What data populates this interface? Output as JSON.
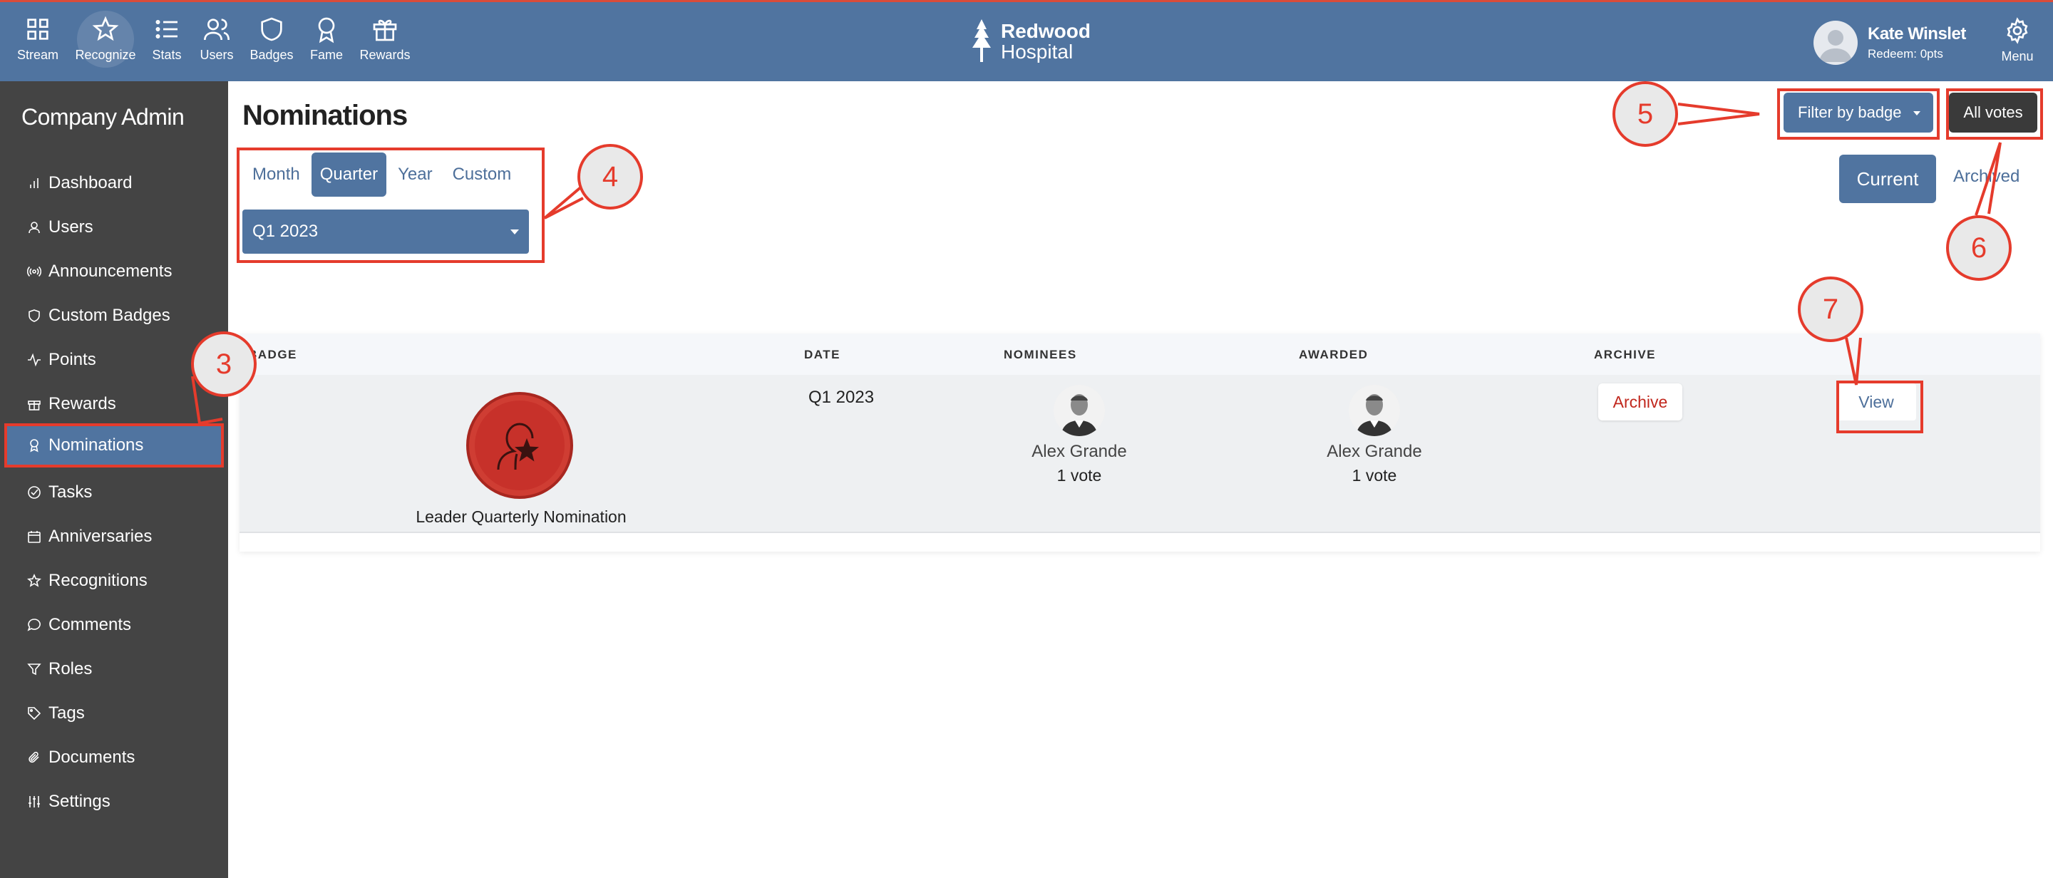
{
  "topbar": {
    "nav": [
      {
        "label": "Stream",
        "icon": "grid-icon"
      },
      {
        "label": "Recognize",
        "icon": "star-icon"
      },
      {
        "label": "Stats",
        "icon": "list-icon"
      },
      {
        "label": "Users",
        "icon": "users-icon"
      },
      {
        "label": "Badges",
        "icon": "shield-icon"
      },
      {
        "label": "Fame",
        "icon": "award-icon"
      },
      {
        "label": "Rewards",
        "icon": "gift-icon"
      }
    ],
    "brand_line1": "Redwood",
    "brand_line2": "Hospital",
    "user_name": "Kate Winslet",
    "user_redeem": "Redeem: 0pts",
    "menu_label": "Menu"
  },
  "sidebar": {
    "title": "Company Admin",
    "items": [
      {
        "label": "Dashboard",
        "icon": "bar-chart-icon"
      },
      {
        "label": "Users",
        "icon": "user-icon"
      },
      {
        "label": "Announcements",
        "icon": "broadcast-icon"
      },
      {
        "label": "Custom Badges",
        "icon": "shield-icon"
      },
      {
        "label": "Points",
        "icon": "activity-icon"
      },
      {
        "label": "Rewards",
        "icon": "gift-icon"
      },
      {
        "label": "Nominations",
        "icon": "award-icon"
      },
      {
        "label": "Tasks",
        "icon": "check-circle-icon"
      },
      {
        "label": "Anniversaries",
        "icon": "calendar-icon"
      },
      {
        "label": "Recognitions",
        "icon": "star-icon"
      },
      {
        "label": "Comments",
        "icon": "comment-icon"
      },
      {
        "label": "Roles",
        "icon": "filter-icon"
      },
      {
        "label": "Tags",
        "icon": "tag-icon"
      },
      {
        "label": "Documents",
        "icon": "paperclip-icon"
      },
      {
        "label": "Settings",
        "icon": "sliders-icon"
      }
    ],
    "active_index": 6
  },
  "main": {
    "title": "Nominations",
    "period_tabs": [
      "Month",
      "Quarter",
      "Year",
      "Custom"
    ],
    "active_tab": "Quarter",
    "period_select_value": "Q1 2023",
    "filter_button": "Filter by badge",
    "all_votes_button": "All votes",
    "current_button": "Current",
    "archived_link": "Archived"
  },
  "table": {
    "headers": {
      "badge": "BADGE",
      "date": "DATE",
      "nominees": "NOMINEES",
      "awarded": "AWARDED",
      "archive": "ARCHIVE"
    },
    "rows": [
      {
        "badge_name": "Leader Quarterly Nomination",
        "date": "Q1 2023",
        "nominee_name": "Alex Grande",
        "nominee_votes": "1 vote",
        "awarded_name": "Alex Grande",
        "awarded_votes": "1 vote",
        "archive_label": "Archive",
        "view_label": "View"
      }
    ]
  },
  "annotations": [
    "3",
    "4",
    "5",
    "6",
    "7"
  ],
  "colors": {
    "primary": "#5074a0",
    "sidebar": "#444444",
    "highlight": "#e53b2c",
    "archive": "#c1271d"
  }
}
